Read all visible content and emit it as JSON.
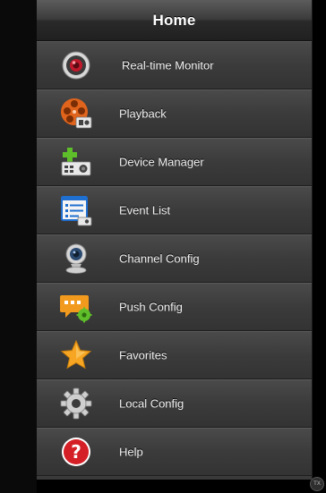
{
  "header": {
    "title": "Home"
  },
  "menu": {
    "items": [
      {
        "label": "Real-time Monitor",
        "icon": "camera-lens-icon"
      },
      {
        "label": "Playback",
        "icon": "film-reel-icon"
      },
      {
        "label": "Device Manager",
        "icon": "device-add-icon"
      },
      {
        "label": "Event List",
        "icon": "list-document-icon"
      },
      {
        "label": "Channel Config",
        "icon": "webcam-icon"
      },
      {
        "label": "Push Config",
        "icon": "message-settings-icon"
      },
      {
        "label": "Favorites",
        "icon": "star-icon"
      },
      {
        "label": "Local Config",
        "icon": "gear-icon"
      },
      {
        "label": "Help",
        "icon": "help-icon"
      }
    ]
  },
  "colors": {
    "panel": "#3a3a3a",
    "title_bar": "#2a2a2a",
    "text": "#f2f2f2"
  },
  "badge": {
    "label": "TX"
  }
}
